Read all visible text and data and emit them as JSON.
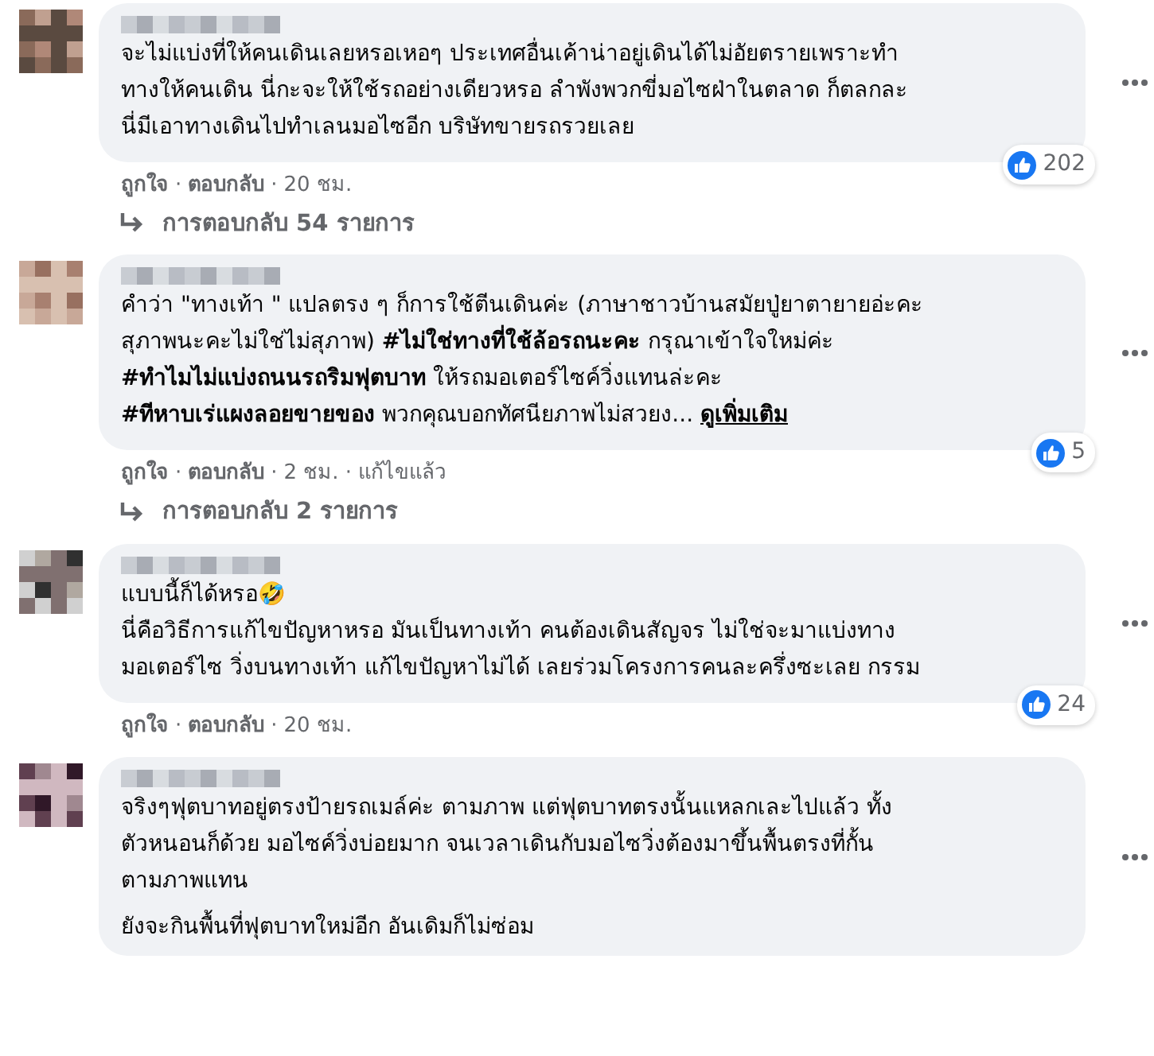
{
  "comments": [
    {
      "paragraphs": [
        [
          "จะไม่แบ่งที่ให้คนเดินเลยหรอเหอๆ ประเทศอื่นเค้าน่าอยู่เดินได้ไม่อัยตรายเพราะทำ",
          "ทางให้คนเดิน นี่กะจะให้ใช้รถอย่างเดียวหรอ ลำพังพวกขี่มอไซฝ่าในตลาด ก็ตลกละ",
          "นี่มีเอาทางเดินไปทำเลนมอไซอีก บริษัทขายรถรวยเลย"
        ]
      ],
      "like_count": "202",
      "actions": [
        {
          "kind": "link",
          "text": "ถูกใจ"
        },
        {
          "kind": "sep",
          "text": "·"
        },
        {
          "kind": "link",
          "text": "ตอบกลับ"
        },
        {
          "kind": "sep",
          "text": "·"
        },
        {
          "kind": "time",
          "text": "20 ชม."
        }
      ],
      "replies": "การตอบกลับ 54 รายการ"
    },
    {
      "paragraphs": [
        [
          "คำว่า \"ทางเท้า \" แปลตรง ๆ ก็การใช้ตีนเดินค่ะ (ภาษาชาวบ้านสมัยปู่ยาตายายอ่ะคะ",
          "สุภาพนะคะไม่ใช่ไม่สุภาพ) **#ไม่ใช่ทางที่ใช้ล้อรถนะคะ** กรุณาเข้าใจใหม่ค่ะ",
          "**#ทำไมไม่แบ่งถนนรถริมฟุตบาท** ให้รถมอเตอร์ไซค์วิ่งแทนล่ะคะ",
          "**#ทีหาบเร่แผงลอยขายของ** พวกคุณบอกทัศนียภาพไม่สวยง..."
        ]
      ],
      "see_more": "ดูเพิ่มเติม",
      "like_count": "5",
      "actions": [
        {
          "kind": "link",
          "text": "ถูกใจ"
        },
        {
          "kind": "sep",
          "text": "·"
        },
        {
          "kind": "link",
          "text": "ตอบกลับ"
        },
        {
          "kind": "sep",
          "text": "·"
        },
        {
          "kind": "time",
          "text": "2 ชม."
        },
        {
          "kind": "sep",
          "text": "·"
        },
        {
          "kind": "edited",
          "text": "แก้ไขแล้ว"
        }
      ],
      "replies": "การตอบกลับ 2 รายการ"
    },
    {
      "paragraphs": [
        [
          "แบบนี้ก็ได้หรอ🤣",
          "นี่คือวิธีการแก้ไขปัญหาหรอ มันเป็นทางเท้า คนต้องเดินสัญจร ไม่ใช่จะมาแบ่งทาง",
          "มอเตอร์ไซ วิ่งบนทางเท้า แก้ไขปัญหาไม่ได้ เลยร่วมโครงการคนละครึ่งซะเลย กรรม"
        ]
      ],
      "like_count": "24",
      "actions": [
        {
          "kind": "link",
          "text": "ถูกใจ"
        },
        {
          "kind": "sep",
          "text": "·"
        },
        {
          "kind": "link",
          "text": "ตอบกลับ"
        },
        {
          "kind": "sep",
          "text": "·"
        },
        {
          "kind": "time",
          "text": "20 ชม."
        }
      ]
    },
    {
      "paragraphs": [
        [
          "จริงๆฟุตบาทอยู่ตรงป้ายรถเมล์ค่ะ ตามภาพ แต่ฟุตบาทตรงนั้นแหลกเละไปแล้ว ทั้ง",
          "ตัวหนอนก็ด้วย มอไซค์วิ่งบ่อยมาก จนเวลาเดินกับมอไซวิ่งต้องมาขึ้นพื้นตรงที่กั้น",
          "ตามภาพแทน"
        ],
        [
          "ยังจะกินพื้นที่ฟุตบาทใหม่อีก อันเดิมก็ไม่ซ่อม"
        ]
      ]
    }
  ]
}
